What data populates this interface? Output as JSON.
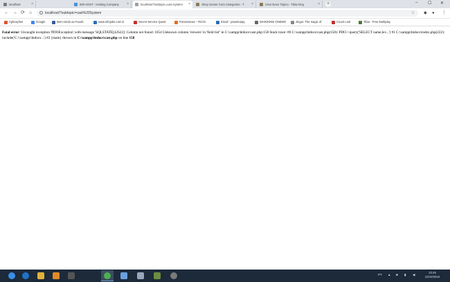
{
  "tabs": [
    {
      "label": "localhost",
      "color": "#7b7b7b"
    },
    {
      "label": "000 HOST - Hosting Company",
      "color": "#4a90d9"
    },
    {
      "label": "localhost/?subtopic=cast System",
      "color": "#9e9e9e"
    },
    {
      "label": "Shop Gemer Core Categories - T",
      "color": "#8a7b5a"
    },
    {
      "label": "Criar Novo Tópico - Tibia King",
      "color": "#8a7b5a"
    }
  ],
  "toolbar": {
    "url": "localhost/?subtopic=cast%20System",
    "back_icon": "←",
    "forward_icon": "→",
    "reload_icon": "⟳",
    "home_icon": "⌂",
    "star_icon": "☆",
    "menu_icon": "⋮"
  },
  "bookmarks": [
    {
      "label": "Aplicações",
      "color": "#e0522b"
    },
    {
      "label": "Google",
      "color": "#4285f4"
    },
    {
      "label": "Bem-vindo ao Faceb",
      "color": "#3b5998"
    },
    {
      "label": "www.infojobs.com.b",
      "color": "#2a6fb6"
    },
    {
      "label": "Secret Service Quest",
      "color": "#c03030"
    },
    {
      "label": "PontoSense - TECN",
      "color": "#e07020"
    },
    {
      "label": "Email - josantospq",
      "color": "#2a6fb6"
    },
    {
      "label": "WARZONE ONEMO",
      "color": "#666666"
    },
    {
      "label": "Jingui: The magic of",
      "color": "#888888"
    },
    {
      "label": "Count Lost",
      "color": "#c03030"
    },
    {
      "label": "Tibia - Free Multiplay",
      "color": "#4a7a3a"
    }
  ],
  "error": {
    "label": "Fatal error",
    "message": ": Uncaught exception 'PDOException' with message 'SQLSTATE[42S22]: Column not found: 1054 Unknown column 'viewers' in 'field list'' in C:\\xampp\\htdocs\\cast.php:158 Stack trace: #0 C:\\xampp\\htdocs\\cast.php(158): PDO->query('SELECT name,lev...') #1 C:\\xampp\\htdocs\\index.php(222): include('C:\\\\xampp\\\\htdocs...') #2 {main} thrown in ",
    "file": "C:\\xampp\\htdocs\\cast.php",
    "on_line": " on line ",
    "line": "158"
  },
  "taskbar": {
    "items": [
      {
        "name": "start",
        "color": "#3a8ee6"
      },
      {
        "name": "ie",
        "color": "#1e73c8"
      },
      {
        "name": "explorer",
        "color": "#e2b13c"
      },
      {
        "name": "media",
        "color": "#e08a2a"
      },
      {
        "name": "app5",
        "color": "#555555"
      },
      {
        "name": "chrome",
        "color": "#4caf50"
      },
      {
        "name": "app7",
        "color": "#6aa0e0"
      },
      {
        "name": "app8",
        "color": "#9aa7b8"
      },
      {
        "name": "app9",
        "color": "#6c8e3e"
      },
      {
        "name": "app10",
        "color": "#7a7a7a"
      }
    ],
    "lang": "PT",
    "time": "22:49",
    "date": "23/10/2018"
  }
}
